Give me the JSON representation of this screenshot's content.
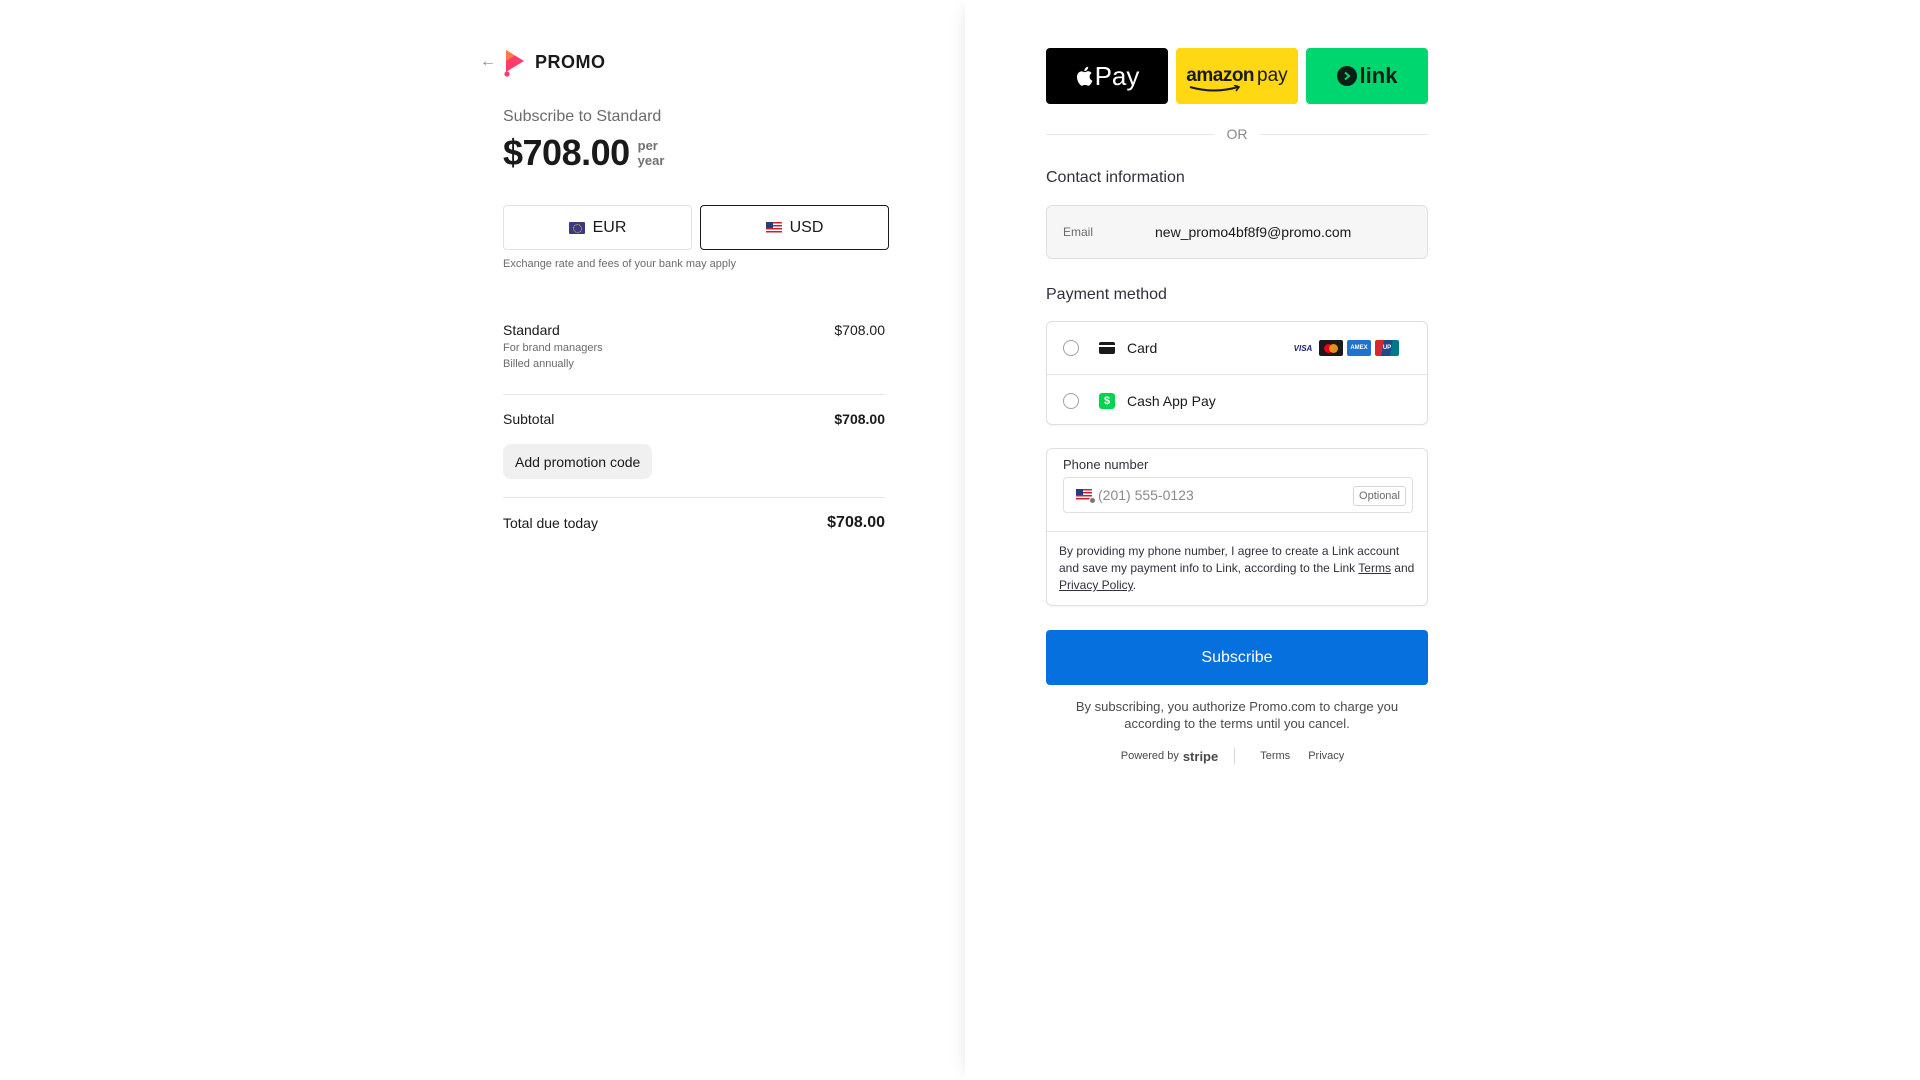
{
  "header": {
    "back_icon": "back-arrow-icon",
    "logo_text": "PROMO",
    "brand_color": "#ff3b6b"
  },
  "summary": {
    "subscribe_to": "Subscribe to Standard",
    "price": "$708.00",
    "period_line1": "per",
    "period_line2": "year"
  },
  "currency": {
    "options": [
      {
        "code": "EUR",
        "selected": false
      },
      {
        "code": "USD",
        "selected": true
      }
    ],
    "note": "Exchange rate and fees of your bank may apply"
  },
  "line_item": {
    "name": "Standard",
    "price": "$708.00",
    "description": "For brand managers",
    "billing": "Billed annually"
  },
  "subtotal": {
    "label": "Subtotal",
    "value": "$708.00"
  },
  "promo": {
    "label": "Add promotion code"
  },
  "total": {
    "label": "Total due today",
    "value": "$708.00"
  },
  "wallets": {
    "apple_pay": "Pay",
    "amazon_word": "amazon",
    "amazon_pay": "pay",
    "link": "link"
  },
  "divider_or": "OR",
  "contact": {
    "title": "Contact information",
    "email_label": "Email",
    "email_value": "new_promo4bf8f9@promo.com"
  },
  "payment": {
    "title": "Payment method",
    "methods": [
      {
        "label": "Card",
        "icon": "card-icon",
        "selected": false
      },
      {
        "label": "Cash App Pay",
        "icon": "cash-app-icon",
        "selected": false
      }
    ],
    "card_brands": [
      "VISA",
      "MC",
      "AMEX",
      "UnionPay"
    ]
  },
  "phone": {
    "label": "Phone number",
    "placeholder": "(201) 555-0123",
    "optional": "Optional",
    "consent_pre": "By providing my phone number, I agree to create a Link account and save my payment info to Link, according to the Link ",
    "terms": "Terms",
    "and": " and ",
    "privacy": "Privacy Policy",
    "end": "."
  },
  "subscribe": {
    "label": "Subscribe",
    "color": "#0570de"
  },
  "authorize_text": "By subscribing, you authorize Promo.com to charge you according to the terms until you cancel.",
  "footer": {
    "powered_by": "Powered by",
    "stripe": "stripe",
    "terms": "Terms",
    "privacy": "Privacy"
  }
}
